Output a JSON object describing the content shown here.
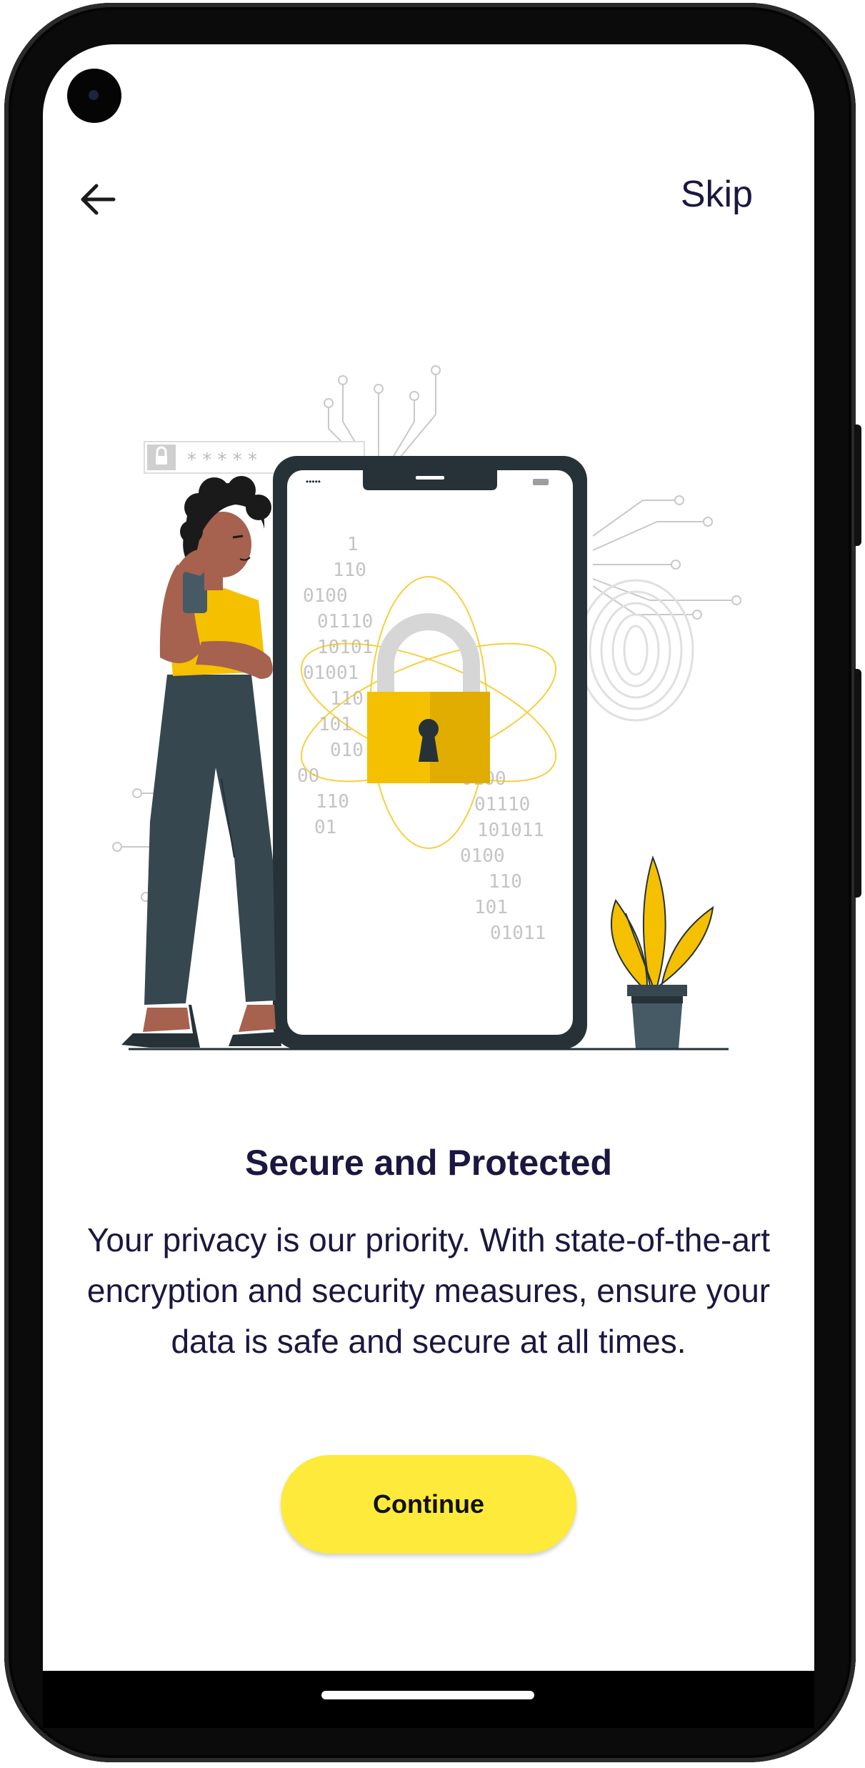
{
  "nav": {
    "back_icon": "arrow-left-icon",
    "skip_label": "Skip"
  },
  "illustration": {
    "subject": "person-with-phone-and-padlock",
    "password_field_mask": "* * * * *",
    "binary_lines_left": [
      "1",
      "110",
      "0100",
      "01110",
      "10101",
      "01001",
      "110",
      "101",
      "010",
      "00",
      "110",
      "01"
    ],
    "binary_lines_right": [
      "0100",
      "01110",
      "101011",
      "0100",
      "110",
      "101",
      "01011"
    ]
  },
  "content": {
    "title": "Secure and Protected",
    "description": "Your privacy is our priority. With state-of-the-art encryption and security measures, ensure your data is safe and secure at all times."
  },
  "actions": {
    "continue_label": "Continue"
  },
  "colors": {
    "accent_yellow": "#fdea3a",
    "lock_yellow": "#f5c000",
    "text_dark": "#1b1740",
    "phone_body": "#263238"
  }
}
